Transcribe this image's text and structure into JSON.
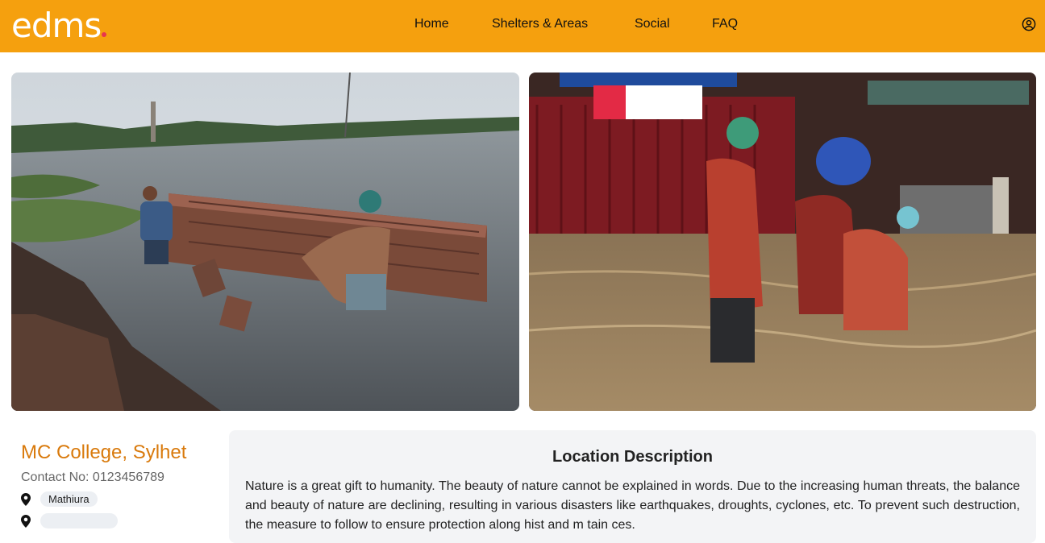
{
  "header": {
    "logo_text": "edms",
    "logo_dot_color": "#e8344e",
    "bar_color": "#f5a00e",
    "nav": [
      "Home",
      "Shelters & Areas",
      "Social",
      "FAQ"
    ],
    "user_icon": "user-circle-icon"
  },
  "gallery": {
    "photos": [
      "men-building-brick-wall-in-floodwater-photo",
      "family-wading-through-flooded-street-photo"
    ]
  },
  "location": {
    "name": "MC College, Sylhet",
    "contact": "Contact No: 0123456789",
    "areas": [
      "Mathiura",
      ""
    ],
    "pin_icon": "map-pin-icon",
    "accent_color": "#d97a0c"
  },
  "description": {
    "title": "Location Description",
    "body": "Nature is a great gift to humanity. The beauty of nature cannot be explained in words. Due to the increasing human threats, the balance and beauty of nature are declining, resulting in various disasters like earthquakes, droughts, cyclones, etc. To prevent such destruction, the measure to follow to ensure protection along hist and m tain ces."
  }
}
